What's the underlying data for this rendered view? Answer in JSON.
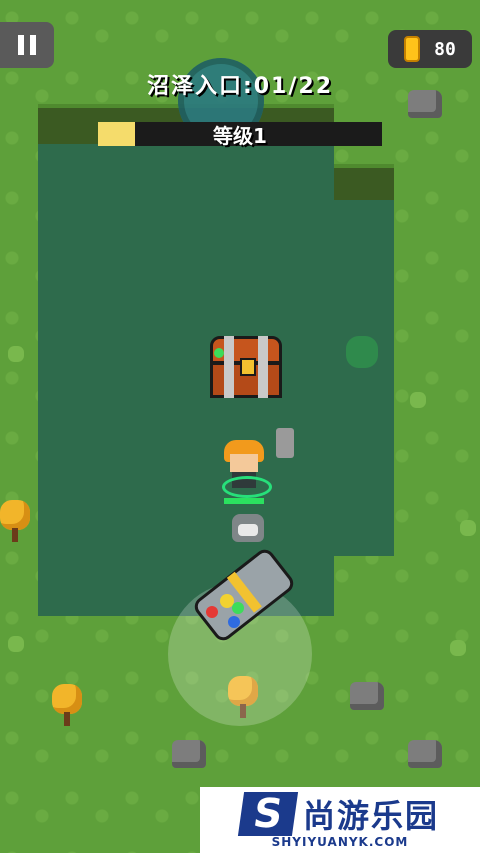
{
  "hud": {
    "pause_icon": "pause-icon",
    "coin_icon": "coin-icon",
    "coin_count": "80",
    "stage_label": "沼泽入口:01/22",
    "level_label": "等级1",
    "level_progress": 0.13
  },
  "colors": {
    "grass": "#5ea03a",
    "swamp": "#2e6b4c",
    "hp": "#2be05f",
    "level_fill": "#f5dc6b",
    "coin": "#ffc21a"
  },
  "player": {
    "health": 1.0
  },
  "watermark": {
    "logo_text": "S",
    "name": "尚游乐园",
    "url": "SHYIYUANYK.COM"
  }
}
